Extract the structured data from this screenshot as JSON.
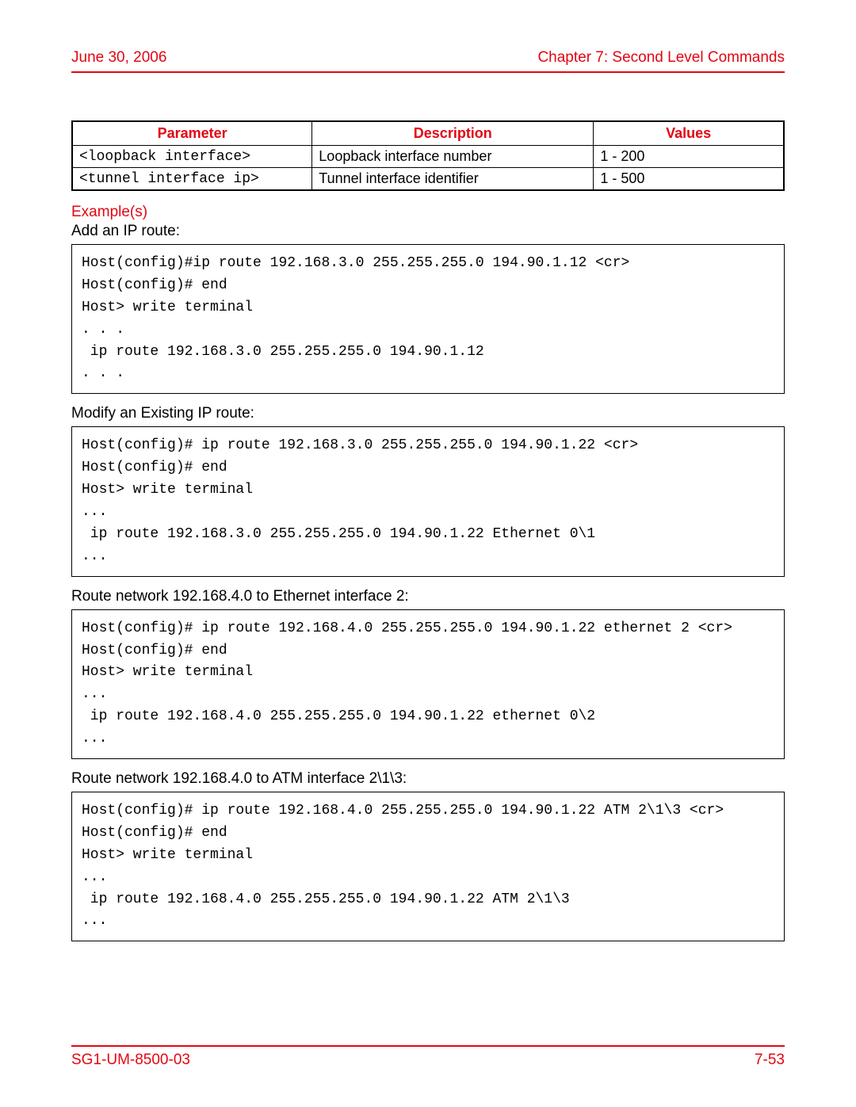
{
  "header": {
    "date": "June 30, 2006",
    "chapter": "Chapter 7: Second Level Commands"
  },
  "table": {
    "headers": {
      "param": "Parameter",
      "desc": "Description",
      "values": "Values"
    },
    "rows": [
      {
        "param": "<loopback interface>",
        "desc": "Loopback interface number",
        "values": "1 - 200"
      },
      {
        "param": "<tunnel interface ip>",
        "desc": "Tunnel interface identifier",
        "values": "1 - 500"
      }
    ]
  },
  "examples_heading": "Example(s)",
  "sections": [
    {
      "text": "Add an IP route:",
      "code": "Host(config)#ip route 192.168.3.0 255.255.255.0 194.90.1.12 <cr>\nHost(config)# end\nHost> write terminal\n. . .\n ip route 192.168.3.0 255.255.255.0 194.90.1.12\n. . ."
    },
    {
      "text": "Modify an Existing IP route:",
      "code": "Host(config)# ip route 192.168.3.0 255.255.255.0 194.90.1.22 <cr>\nHost(config)# end\nHost> write terminal\n...\n ip route 192.168.3.0 255.255.255.0 194.90.1.22 Ethernet 0\\1\n..."
    },
    {
      "text": "Route network 192.168.4.0 to Ethernet interface 2:",
      "code": "Host(config)# ip route 192.168.4.0 255.255.255.0 194.90.1.22 ethernet 2 <cr>\nHost(config)# end\nHost> write terminal\n...\n ip route 192.168.4.0 255.255.255.0 194.90.1.22 ethernet 0\\2\n..."
    },
    {
      "text": "Route network 192.168.4.0 to ATM interface 2\\1\\3:",
      "code": "Host(config)# ip route 192.168.4.0 255.255.255.0 194.90.1.22 ATM 2\\1\\3 <cr>\nHost(config)# end\nHost> write terminal\n...\n ip route 192.168.4.0 255.255.255.0 194.90.1.22 ATM 2\\1\\3\n..."
    }
  ],
  "footer": {
    "doc_id": "SG1-UM-8500-03",
    "page": "7-53"
  }
}
